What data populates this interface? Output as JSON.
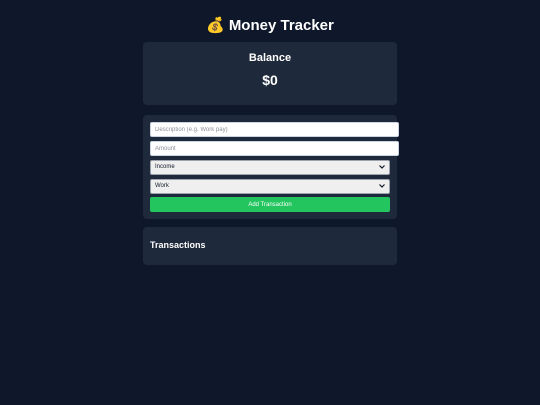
{
  "app": {
    "icon": "money-bag-icon",
    "icon_glyph": "💰",
    "title": "Money Tracker"
  },
  "balance": {
    "title": "Balance",
    "value": "$0"
  },
  "form": {
    "description_placeholder": "Description (e.g. Work pay)",
    "description_value": "",
    "amount_placeholder": "Amount",
    "amount_value": "",
    "type_selected": "Income",
    "category_selected": "Work",
    "add_button_label": "Add Transaction"
  },
  "transactions": {
    "title": "Transactions",
    "items": []
  },
  "colors": {
    "background": "#0f172a",
    "card": "#1e293b",
    "accent": "#22c55e",
    "text": "#ffffff"
  }
}
